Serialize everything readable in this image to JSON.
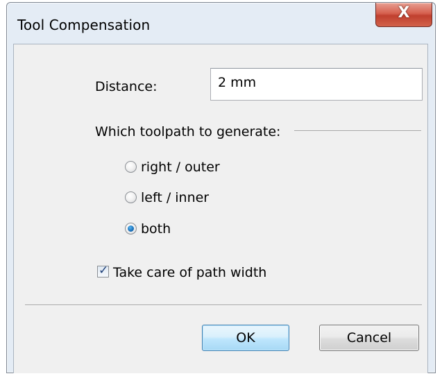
{
  "window": {
    "title": "Tool Compensation",
    "close_glyph": "X"
  },
  "distance": {
    "label": "Distance:",
    "value": "2 mm"
  },
  "toolpath": {
    "group_label": "Which toolpath to generate:",
    "options": [
      {
        "label": "right / outer",
        "selected": false
      },
      {
        "label": "left / inner",
        "selected": false
      },
      {
        "label": "both",
        "selected": true
      }
    ]
  },
  "path_width": {
    "label": "Take care of path width",
    "checked": true
  },
  "buttons": {
    "ok_label": "OK",
    "cancel_label": "Cancel"
  },
  "colors": {
    "frame": "#e4ecf5",
    "client": "#f0f0f0",
    "close_button": "#c7432f",
    "ok_border": "#3c7fb1"
  }
}
